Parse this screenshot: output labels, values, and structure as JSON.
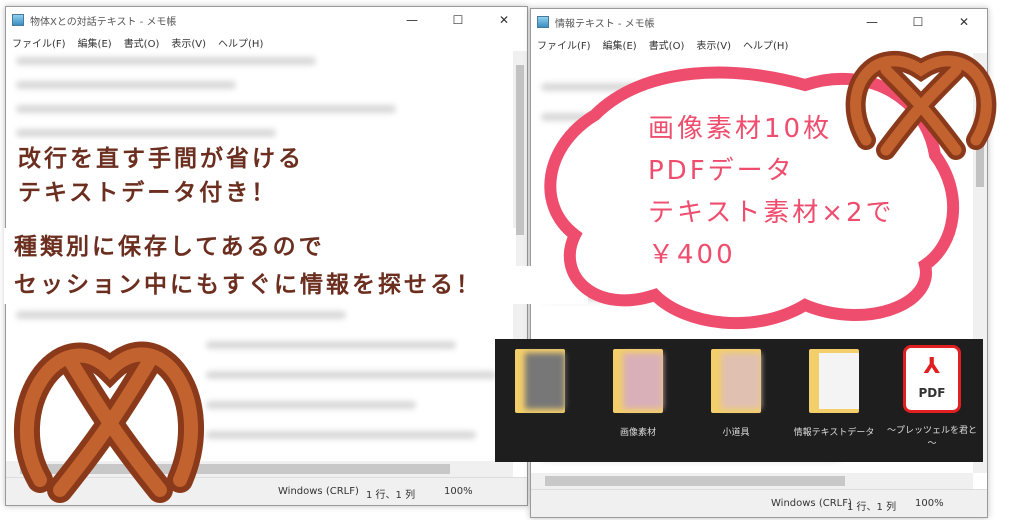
{
  "left_window": {
    "title": "物体Xとの対話テキスト - メモ帳",
    "menu": [
      "ファイル(F)",
      "編集(E)",
      "書式(O)",
      "表示(V)",
      "ヘルプ(H)"
    ],
    "status": {
      "eol": "Windows (CRLF)",
      "position": "1 行、1 列",
      "zoom": "100%"
    }
  },
  "right_window": {
    "title": "情報テキスト - メモ帳",
    "menu": [
      "ファイル(F)",
      "編集(E)",
      "書式(O)",
      "表示(V)",
      "ヘルプ(H)"
    ],
    "status": {
      "eol": "Windows (CRLF)",
      "position": "1 行、1 列",
      "zoom": "100%"
    }
  },
  "captions": [
    "改行を直す手間が省ける",
    "テキストデータ付き！",
    "種類別に保存してあるので",
    "セッション中にもすぐに情報を探せる！"
  ],
  "cloud": [
    "画像素材10枚",
    "PDFデータ",
    "テキスト素材×2で",
    "￥400"
  ],
  "files": [
    {
      "name": ""
    },
    {
      "name": "画像素材"
    },
    {
      "name": "小道具"
    },
    {
      "name": "情報テキストデータ"
    },
    {
      "name": "～プレッツェルを君と～",
      "icon_label": "PDF"
    }
  ],
  "colors": {
    "caption": "#6b2e1f",
    "cloud": "#ef4d6d",
    "pdf": "#e02020"
  }
}
